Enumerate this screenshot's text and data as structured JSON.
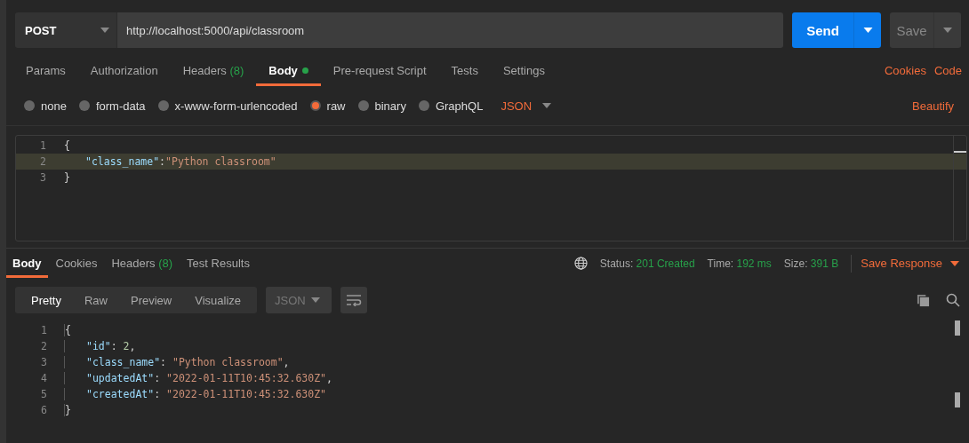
{
  "request": {
    "method": "POST",
    "url": "http://localhost:5000/api/classroom",
    "send": "Send",
    "save": "Save"
  },
  "request_tabs": [
    {
      "label": "Params",
      "dot": false,
      "selected": false
    },
    {
      "label": "Authorization",
      "dot": false,
      "selected": false
    },
    {
      "label": "Headers",
      "count": "(8)",
      "dot": false,
      "selected": false
    },
    {
      "label": "Body",
      "dot": true,
      "selected": true
    },
    {
      "label": "Pre-request Script",
      "dot": false,
      "selected": false
    },
    {
      "label": "Tests",
      "dot": false,
      "selected": false
    },
    {
      "label": "Settings",
      "dot": false,
      "selected": false
    }
  ],
  "request_links": [
    "Cookies",
    "Code"
  ],
  "body_types": [
    {
      "label": "none",
      "selected": false
    },
    {
      "label": "form-data",
      "selected": false
    },
    {
      "label": "x-www-form-urlencoded",
      "selected": false
    },
    {
      "label": "raw",
      "selected": true
    },
    {
      "label": "binary",
      "selected": false
    },
    {
      "label": "GraphQL",
      "selected": false
    }
  ],
  "body_format": "JSON",
  "beautify": "Beautify",
  "request_body": [
    {
      "number": "1",
      "indented": false,
      "highlighted": false,
      "tokens": [
        {
          "kind": "brace",
          "text": "{"
        }
      ]
    },
    {
      "number": "2",
      "indented": true,
      "highlighted": true,
      "tokens": [
        {
          "kind": "key",
          "text": "\"class_name\""
        },
        {
          "kind": "punct",
          "text": ":"
        },
        {
          "kind": "string",
          "text": "\"Python classroom\""
        }
      ]
    },
    {
      "number": "3",
      "indented": false,
      "highlighted": false,
      "tokens": [
        {
          "kind": "brace",
          "text": "}"
        }
      ]
    }
  ],
  "response_tabs": [
    {
      "label": "Body",
      "selected": true
    },
    {
      "label": "Cookies",
      "selected": false
    },
    {
      "label": "Headers",
      "count": "(8)",
      "selected": false
    },
    {
      "label": "Test Results",
      "selected": false
    }
  ],
  "status": [
    {
      "label": "Status:",
      "value": "201 Created"
    },
    {
      "label": "Time:",
      "value": "192 ms"
    },
    {
      "label": "Size:",
      "value": "391 B"
    }
  ],
  "save_response": "Save Response",
  "view_modes": [
    {
      "label": "Pretty",
      "selected": true
    },
    {
      "label": "Raw",
      "selected": false
    },
    {
      "label": "Preview",
      "selected": false
    },
    {
      "label": "Visualize",
      "selected": false
    }
  ],
  "response_format": "JSON",
  "response_body": [
    {
      "number": "1",
      "indented": false,
      "tokens": [
        {
          "kind": "brace",
          "text": "{"
        }
      ]
    },
    {
      "number": "2",
      "indented": true,
      "tokens": [
        {
          "kind": "key",
          "text": "\"id\""
        },
        {
          "kind": "punct",
          "text": ": "
        },
        {
          "kind": "number",
          "text": "2"
        },
        {
          "kind": "punct",
          "text": ","
        }
      ]
    },
    {
      "number": "3",
      "indented": true,
      "tokens": [
        {
          "kind": "key",
          "text": "\"class_name\""
        },
        {
          "kind": "punct",
          "text": ": "
        },
        {
          "kind": "string",
          "text": "\"Python classroom\""
        },
        {
          "kind": "punct",
          "text": ","
        }
      ]
    },
    {
      "number": "4",
      "indented": true,
      "tokens": [
        {
          "kind": "key",
          "text": "\"updatedAt\""
        },
        {
          "kind": "punct",
          "text": ": "
        },
        {
          "kind": "string",
          "text": "\"2022-01-11T10:45:32.630Z\""
        },
        {
          "kind": "punct",
          "text": ","
        }
      ]
    },
    {
      "number": "5",
      "indented": true,
      "tokens": [
        {
          "kind": "key",
          "text": "\"createdAt\""
        },
        {
          "kind": "punct",
          "text": ": "
        },
        {
          "kind": "string",
          "text": "\"2022-01-11T10:45:32.630Z\""
        }
      ]
    },
    {
      "number": "6",
      "indented": false,
      "tokens": [
        {
          "kind": "brace",
          "text": "}"
        }
      ]
    }
  ]
}
